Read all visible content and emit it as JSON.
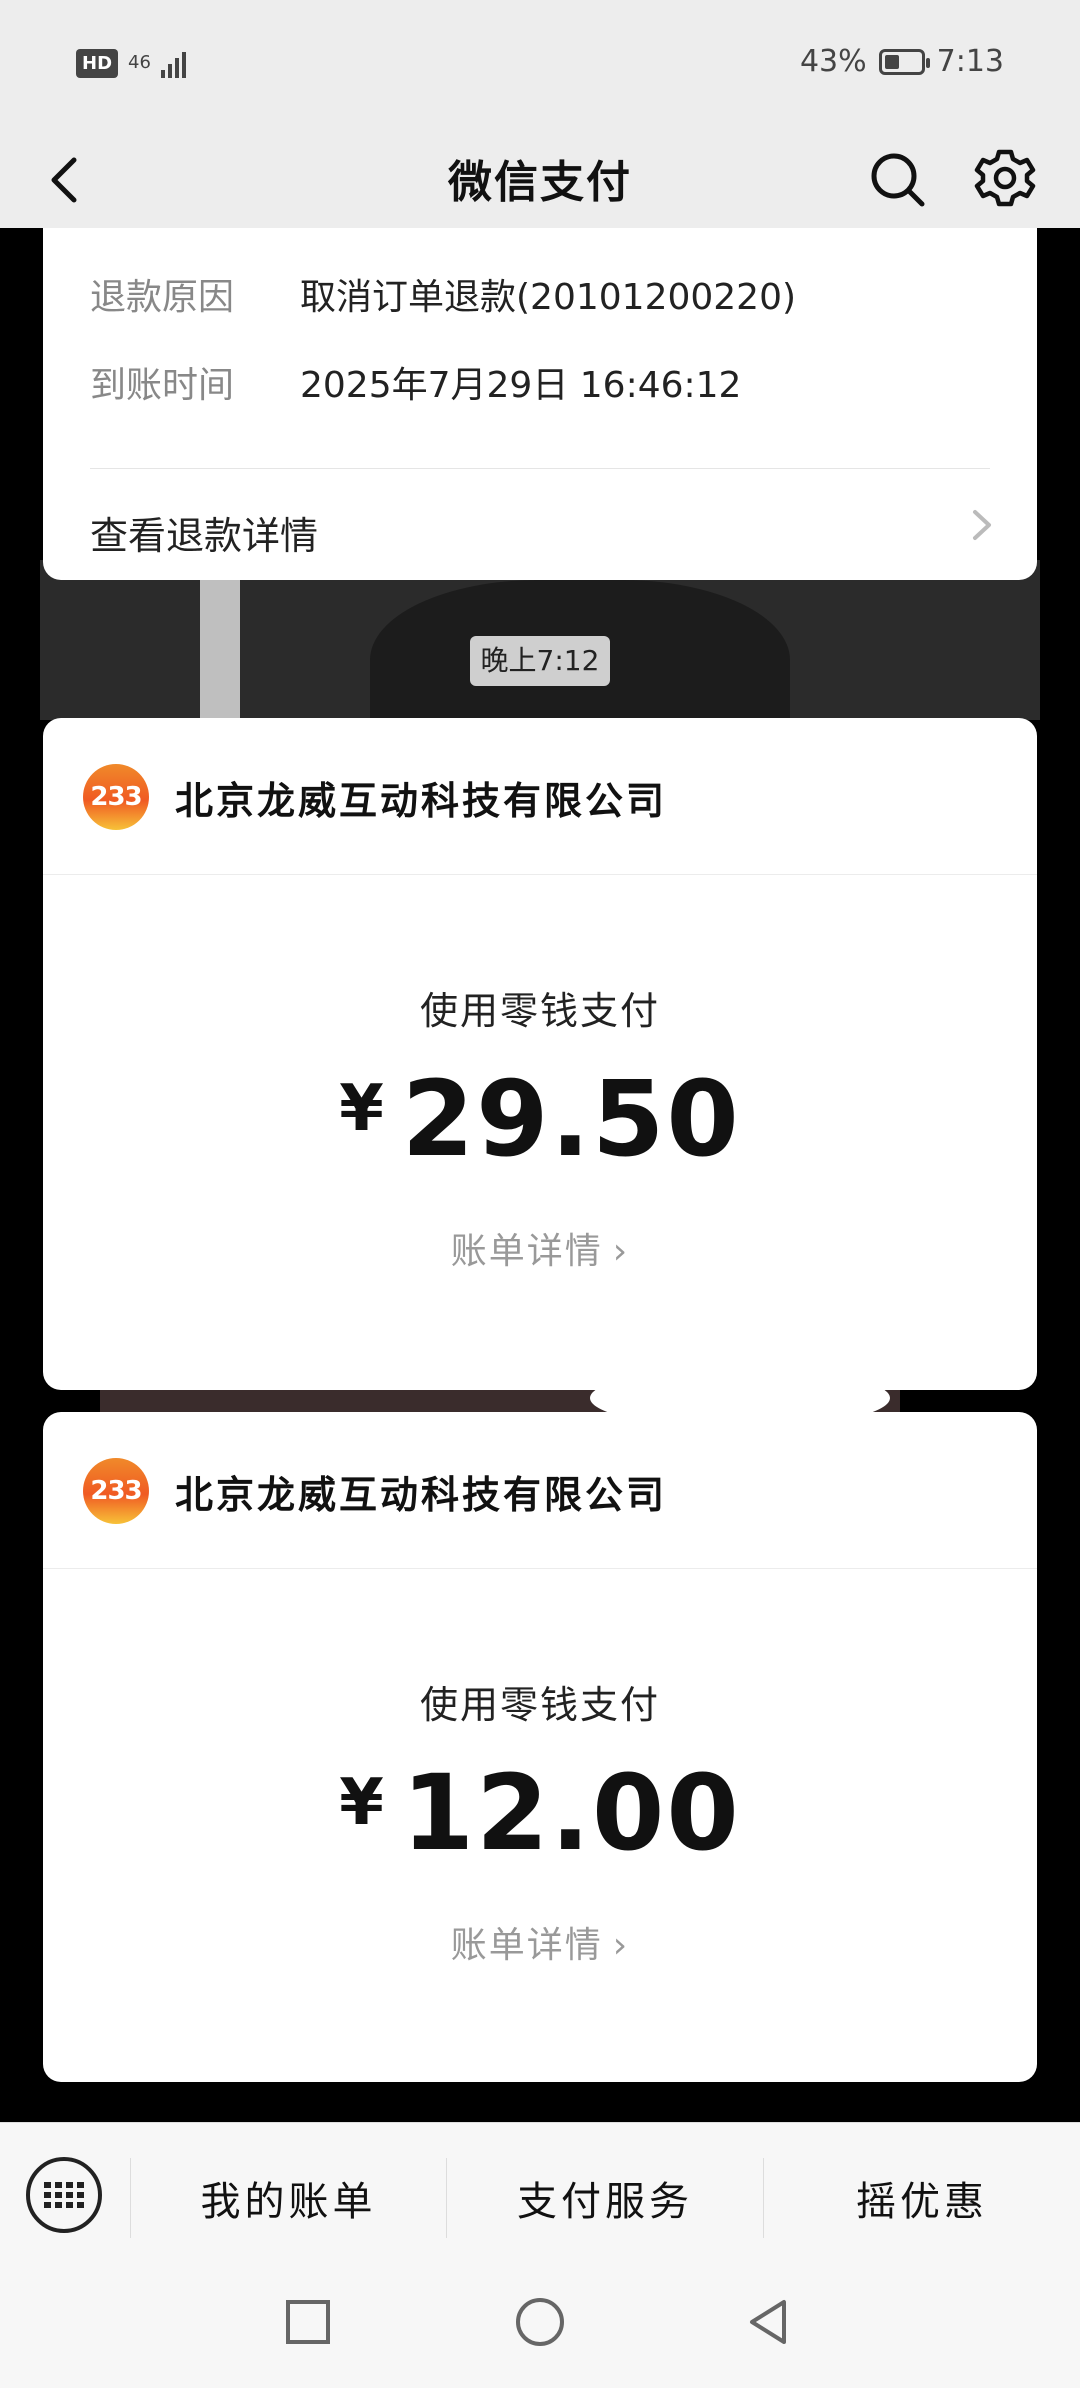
{
  "status_bar": {
    "hd": "HD",
    "network": "46",
    "battery_text": "43%",
    "battery_level": 0.43,
    "time": "7:13"
  },
  "header": {
    "title": "微信支付",
    "back_icon": "chevron-left-icon",
    "search_icon": "search-icon",
    "settings_icon": "gear-icon"
  },
  "refund_card": {
    "rows": [
      {
        "key": "退款原因",
        "value": "取消订单退款(20101200220)"
      },
      {
        "key": "到账时间",
        "value": "2025年7月29日 16:46:12"
      }
    ],
    "link": "查看退款详情"
  },
  "time_divider": "晚上7:12",
  "payments": [
    {
      "merchant_logo": "233",
      "merchant": "北京龙威互动科技有限公司",
      "method": "使用零钱支付",
      "currency": "¥",
      "amount": "29.50",
      "detail": "账单详情",
      "detail_arrow": "›"
    },
    {
      "merchant_logo": "233",
      "merchant": "北京龙威互动科技有限公司",
      "method": "使用零钱支付",
      "currency": "¥",
      "amount": "12.00",
      "detail": "账单详情",
      "detail_arrow": "›"
    }
  ],
  "bottom_menu": {
    "keyboard_icon": "keyboard-icon",
    "items": [
      "我的账单",
      "支付服务",
      "摇优惠"
    ]
  },
  "nav": {
    "recent": "square-icon",
    "home": "circle-icon",
    "back": "triangle-back-icon"
  }
}
